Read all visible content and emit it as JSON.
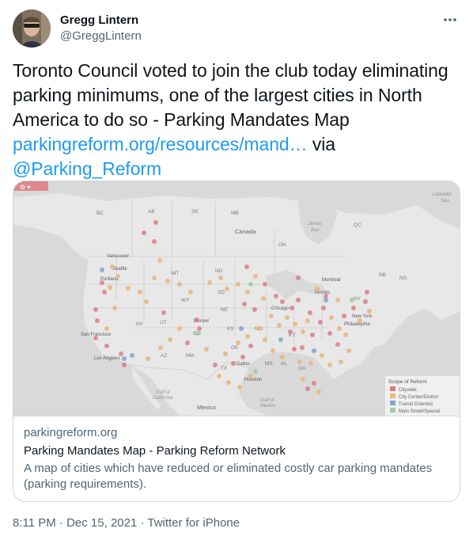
{
  "author": {
    "display_name": "Gregg Lintern",
    "handle": "@GreggLintern",
    "avatar_icon": "profile-photo"
  },
  "more_icon": "ellipsis-icon",
  "tweet": {
    "text": "Toronto Council voted to join the club today eliminating parking minimums, one of the largest cities in North America to do so - Parking Mandates Map ",
    "link_text": "parkingreform.org/resources/mand…",
    "via_text": " via ",
    "mention": "@Parking_Reform"
  },
  "card": {
    "domain": "parkingreform.org",
    "title": "Parking Mandates Map - Parking Reform Network",
    "description": "A map of cities which have reduced or eliminated costly car parking mandates (parking requirements).",
    "map": {
      "region_labels": [
        "BC",
        "AB",
        "SK",
        "MB",
        "Canada",
        "ON",
        "QC",
        "NB",
        "NS",
        "MT",
        "ND",
        "SD",
        "WY",
        "NV",
        "UT",
        "CO",
        "NE",
        "KS",
        "MO",
        "OK",
        "AZ",
        "NM",
        "TX",
        "MS",
        "AL",
        "GA",
        "KY",
        "NY",
        "Mexico"
      ],
      "water_labels": [
        "James Bay",
        "Labrador Sea",
        "Gulf of California",
        "Gulf of Mexico"
      ],
      "city_labels": [
        "Vancouver",
        "Seattle",
        "Portland",
        "San Francisco",
        "Los Angeles",
        "Denver",
        "Dallas",
        "Houston",
        "Montreal",
        "Toronto",
        "New York",
        "Philadelphia",
        "Chicago"
      ],
      "legend": {
        "title": "Scope of Reform",
        "items": [
          {
            "label": "Citywide",
            "color": "#d9747a"
          },
          {
            "label": "City Center/District",
            "color": "#e8b27a"
          },
          {
            "label": "Transit Oriented",
            "color": "#7e9fc7"
          },
          {
            "label": "Main Street/Special",
            "color": "#9fc79a"
          }
        ]
      },
      "toolbar_icon": "settings-icon"
    }
  },
  "meta": {
    "time": "8:11 PM",
    "separator": " · ",
    "date": "Dec 15, 2021",
    "source": "Twitter for iPhone"
  }
}
